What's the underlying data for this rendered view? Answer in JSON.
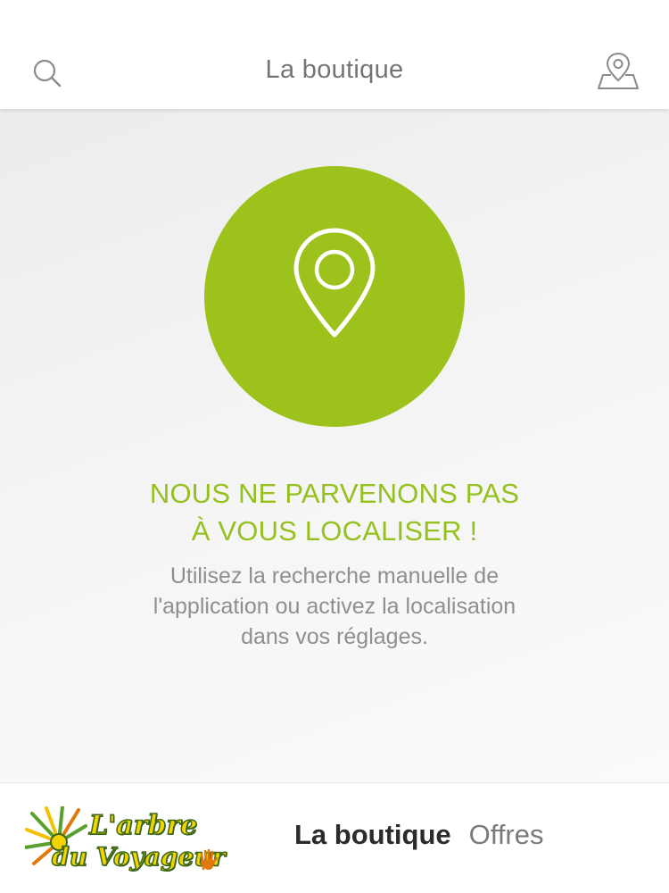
{
  "header": {
    "title": "La boutique",
    "left_icon": "search-icon",
    "right_icon": "map-pin-icon"
  },
  "location_error": {
    "icon": "location-pin-icon",
    "title_lines": [
      "NOUS NE PARVENONS PAS",
      "À VOUS LOCALISER !"
    ],
    "message_lines": [
      "Utilisez la recherche manuelle de",
      "l'application ou activez la localisation",
      "dans vos réglages."
    ]
  },
  "footer": {
    "logo": {
      "line1": "L'arbre",
      "line2": "du Voyageur"
    },
    "tabs": [
      {
        "label": "La boutique",
        "active": true
      },
      {
        "label": "Offres",
        "active": false
      }
    ]
  },
  "colors": {
    "accent": "#95c11f",
    "circle": "#9cc21b",
    "header_text": "#757575",
    "body_text": "#8f8f8f",
    "active_tab": "#2b2b2b",
    "inactive_tab": "#7a7a7a"
  }
}
